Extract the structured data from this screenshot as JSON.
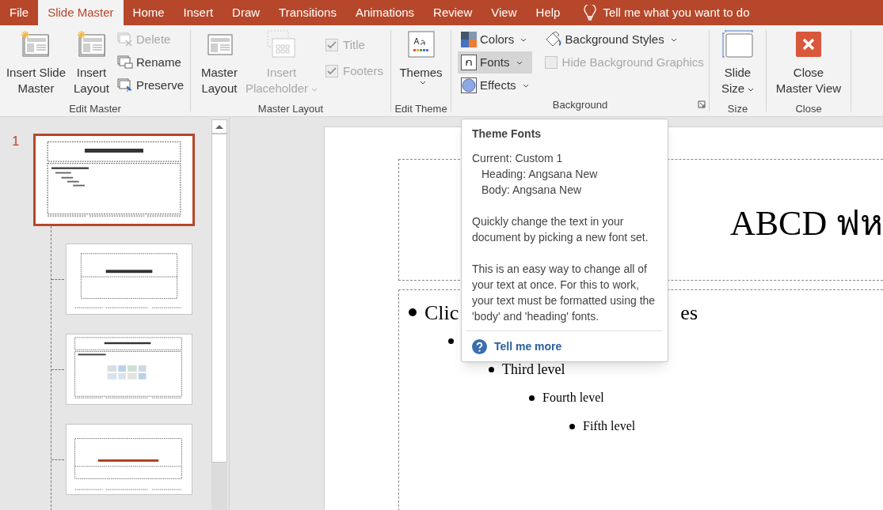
{
  "tabs": [
    {
      "label": "File",
      "selected": false
    },
    {
      "label": "Slide Master",
      "selected": true
    },
    {
      "label": "Home",
      "selected": false
    },
    {
      "label": "Insert",
      "selected": false
    },
    {
      "label": "Draw",
      "selected": false
    },
    {
      "label": "Transitions",
      "selected": false
    },
    {
      "label": "Animations",
      "selected": false
    },
    {
      "label": "Review",
      "selected": false
    },
    {
      "label": "View",
      "selected": false
    },
    {
      "label": "Help",
      "selected": false
    }
  ],
  "tell_me": {
    "placeholder": "Tell me what you want to do"
  },
  "ribbon_groups": [
    {
      "label": "Edit Master",
      "items": [
        {
          "kind": "large",
          "lines": [
            "Insert Slide",
            "Master"
          ],
          "disabled": false,
          "dropdown": false
        },
        {
          "kind": "large",
          "lines": [
            "Insert",
            "Layout"
          ],
          "disabled": false,
          "dropdown": false
        },
        {
          "kind": "stack",
          "items": [
            {
              "kind": "button",
              "label": "Delete",
              "disabled": true,
              "dropdown": false
            },
            {
              "kind": "button",
              "label": "Rename",
              "disabled": false,
              "dropdown": false
            },
            {
              "kind": "button",
              "label": "Preserve",
              "disabled": false,
              "dropdown": false
            }
          ]
        }
      ]
    },
    {
      "label": "Master Layout",
      "items": [
        {
          "kind": "large",
          "lines": [
            "Master",
            "Layout"
          ],
          "disabled": false,
          "dropdown": false
        },
        {
          "kind": "large",
          "lines": [
            "Insert",
            "Placeholder"
          ],
          "disabled": true,
          "dropdown": true
        },
        {
          "kind": "checks",
          "items": [
            {
              "label": "Title",
              "checked": true,
              "disabled": true
            },
            {
              "label": "Footers",
              "checked": true,
              "disabled": true
            }
          ]
        }
      ]
    },
    {
      "label": "Edit Theme",
      "items": [
        {
          "kind": "large",
          "lines": [
            "Themes"
          ],
          "disabled": false,
          "dropdown": true
        }
      ]
    },
    {
      "label": "Background",
      "launcher": true,
      "items": [
        {
          "kind": "stack",
          "items": [
            {
              "kind": "button",
              "label": "Colors",
              "disabled": false,
              "dropdown": true,
              "selected": false
            },
            {
              "kind": "button",
              "label": "Fonts",
              "disabled": false,
              "dropdown": true,
              "selected": true
            },
            {
              "kind": "button",
              "label": "Effects",
              "disabled": false,
              "dropdown": true,
              "selected": false
            }
          ]
        },
        {
          "kind": "stack",
          "items": [
            {
              "kind": "button",
              "label": "Background Styles",
              "disabled": false,
              "dropdown": true,
              "selected": false
            },
            {
              "kind": "check",
              "label": "Hide Background Graphics",
              "checked": false,
              "disabled": true
            }
          ]
        }
      ]
    },
    {
      "label": "Size",
      "items": [
        {
          "kind": "large",
          "lines": [
            "Slide",
            "Size"
          ],
          "disabled": false,
          "dropdown": true
        }
      ]
    },
    {
      "label": "Close",
      "items": [
        {
          "kind": "large",
          "lines": [
            "Close",
            "Master View"
          ],
          "disabled": false,
          "dropdown": false
        }
      ]
    }
  ],
  "thumbnails": [
    {
      "number": "1",
      "selected": true,
      "children": [
        {
          "selected": false
        },
        {
          "selected": false
        },
        {
          "selected": false
        }
      ]
    }
  ],
  "slide": {
    "title": "ABCD ฟห",
    "body": [
      {
        "left": "Clic",
        "right": "es",
        "children": [
          {
            "children": [
              {
                "text": "Third level",
                "children": [
                  {
                    "text": "Fourth level",
                    "children": [
                      {
                        "text": "Fifth level"
                      }
                    ]
                  }
                ]
              }
            ]
          }
        ]
      }
    ]
  },
  "tooltip": {
    "title": "Theme Fonts",
    "lines": [
      "Current: Custom 1",
      "Heading: Angsana New",
      "Body: Angsana New"
    ],
    "paragraphs": [
      "Quickly change the text in your document by picking a new font set.",
      "This is an easy way to change all of your text at once. For this to work, your text must be formatted using the 'body' and 'heading' fonts."
    ],
    "link": "Tell me more"
  }
}
